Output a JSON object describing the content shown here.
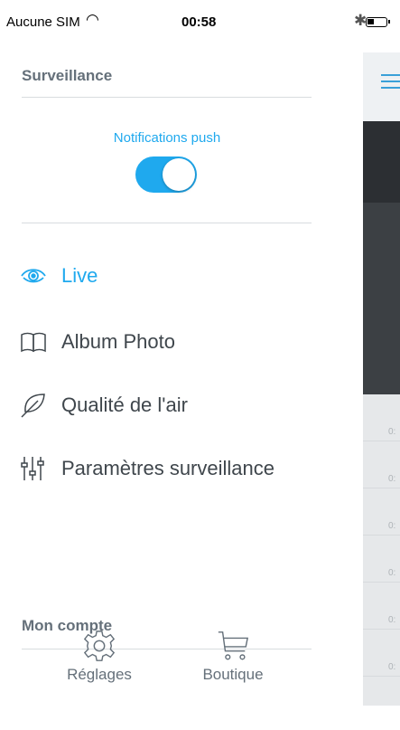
{
  "status_bar": {
    "carrier": "Aucune SIM",
    "time": "00:58"
  },
  "menu": {
    "section_title": "Surveillance",
    "push": {
      "label": "Notifications push",
      "enabled": true
    },
    "items": [
      {
        "label": "Live",
        "icon": "eye-icon",
        "active": true
      },
      {
        "label": "Album Photo",
        "icon": "book-icon",
        "active": false
      },
      {
        "label": "Qualité de l'air",
        "icon": "leaf-icon",
        "active": false
      },
      {
        "label": "Paramètres surveillance",
        "icon": "sliders-icon",
        "active": false
      }
    ],
    "account_title": "Mon compte",
    "bottom": [
      {
        "label": "Réglages",
        "icon": "gear-icon"
      },
      {
        "label": "Boutique",
        "icon": "cart-icon"
      }
    ]
  },
  "preview_rows": [
    "0:",
    "0:",
    "0:",
    "0:",
    "0:",
    "0:"
  ],
  "colors": {
    "accent": "#1fa9ee",
    "text": "#3f464c",
    "muted": "#65707a"
  }
}
